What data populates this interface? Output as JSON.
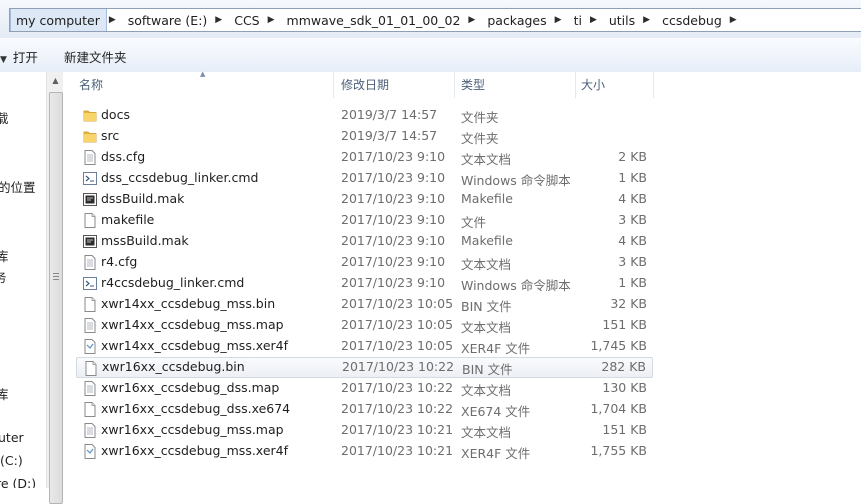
{
  "address": {
    "crumbs": [
      "my computer",
      "software (E:)",
      "CCS",
      "mmwave_sdk_01_01_00_02",
      "packages",
      "ti",
      "utils",
      "ccsdebug"
    ]
  },
  "toolbar": {
    "open_label": "打开",
    "new_folder_label": "新建文件夹"
  },
  "nav": {
    "items": [
      "载",
      "的位置",
      "库",
      "务",
      "库",
      "uter",
      "(C:)",
      "re (D:)"
    ]
  },
  "columns": {
    "name": "名称",
    "date": "修改日期",
    "type": "类型",
    "size": "大小"
  },
  "files": [
    {
      "name": "docs",
      "date": "2019/3/7 14:57",
      "type": "文件夹",
      "size": "",
      "icon": "folder-icon"
    },
    {
      "name": "src",
      "date": "2019/3/7 14:57",
      "type": "文件夹",
      "size": "",
      "icon": "folder-icon"
    },
    {
      "name": "dss.cfg",
      "date": "2017/10/23 9:10",
      "type": "文本文档",
      "size": "2 KB",
      "icon": "text-file-icon"
    },
    {
      "name": "dss_ccsdebug_linker.cmd",
      "date": "2017/10/23 9:10",
      "type": "Windows 命令脚本",
      "size": "1 KB",
      "icon": "cmd-file-icon"
    },
    {
      "name": "dssBuild.mak",
      "date": "2017/10/23 9:10",
      "type": "Makefile",
      "size": "4 KB",
      "icon": "makefile-icon"
    },
    {
      "name": "makefile",
      "date": "2017/10/23 9:10",
      "type": "文件",
      "size": "3 KB",
      "icon": "blank-file-icon"
    },
    {
      "name": "mssBuild.mak",
      "date": "2017/10/23 9:10",
      "type": "Makefile",
      "size": "4 KB",
      "icon": "makefile-icon"
    },
    {
      "name": "r4.cfg",
      "date": "2017/10/23 9:10",
      "type": "文本文档",
      "size": "3 KB",
      "icon": "text-file-icon"
    },
    {
      "name": "r4ccsdebug_linker.cmd",
      "date": "2017/10/23 9:10",
      "type": "Windows 命令脚本",
      "size": "1 KB",
      "icon": "cmd-file-icon"
    },
    {
      "name": "xwr14xx_ccsdebug_mss.bin",
      "date": "2017/10/23 10:05",
      "type": "BIN 文件",
      "size": "32 KB",
      "icon": "blank-file-icon"
    },
    {
      "name": "xwr14xx_ccsdebug_mss.map",
      "date": "2017/10/23 10:05",
      "type": "文本文档",
      "size": "151 KB",
      "icon": "text-file-icon"
    },
    {
      "name": "xwr14xx_ccsdebug_mss.xer4f",
      "date": "2017/10/23 10:05",
      "type": "XER4F 文件",
      "size": "1,745 KB",
      "icon": "generic-file-icon"
    },
    {
      "name": "xwr16xx_ccsdebug.bin",
      "date": "2017/10/23 10:22",
      "type": "BIN 文件",
      "size": "282 KB",
      "icon": "blank-file-icon",
      "selected": true
    },
    {
      "name": "xwr16xx_ccsdebug_dss.map",
      "date": "2017/10/23 10:22",
      "type": "文本文档",
      "size": "130 KB",
      "icon": "text-file-icon"
    },
    {
      "name": "xwr16xx_ccsdebug_dss.xe674",
      "date": "2017/10/23 10:22",
      "type": "XE674 文件",
      "size": "1,704 KB",
      "icon": "blank-file-icon"
    },
    {
      "name": "xwr16xx_ccsdebug_mss.map",
      "date": "2017/10/23 10:21",
      "type": "文本文档",
      "size": "151 KB",
      "icon": "text-file-icon"
    },
    {
      "name": "xwr16xx_ccsdebug_mss.xer4f",
      "date": "2017/10/23 10:21",
      "type": "XER4F 文件",
      "size": "1,755 KB",
      "icon": "generic-file-icon"
    }
  ],
  "colors": {
    "selection_bg": "#eceff4",
    "folder": "#f0c44c",
    "header_text": "#4c607a"
  }
}
